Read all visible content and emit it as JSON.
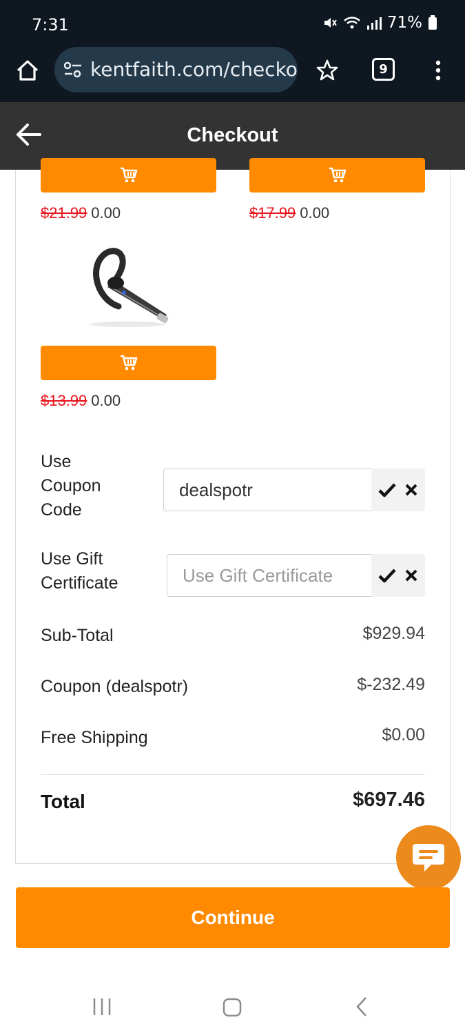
{
  "status_bar": {
    "time": "7:31",
    "battery": "71%",
    "icons": [
      "mute-icon",
      "wifi-icon",
      "signal-icon",
      "battery-icon"
    ]
  },
  "browser": {
    "url": "kentfaith.com/checkout",
    "tab_count": "9",
    "icons": [
      "home-icon",
      "site-settings-icon",
      "bookmark-star-icon",
      "more-vert-icon"
    ]
  },
  "header": {
    "title": "Checkout",
    "back_icon": "arrow-left-icon"
  },
  "products": [
    {
      "old_price": "$21.99",
      "new_price": "0.00"
    },
    {
      "old_price": "$17.99",
      "new_price": "0.00"
    },
    {
      "old_price": "$13.99",
      "new_price": "0.00",
      "image": "bluetooth-headset"
    }
  ],
  "coupon": {
    "label": "Use Coupon Code",
    "value": "dealspotr"
  },
  "gift": {
    "label": "Use Gift Certificate",
    "placeholder": "Use Gift Certificate",
    "value": ""
  },
  "totals": {
    "rows": [
      {
        "label": "Sub-Total",
        "value": "$929.94"
      },
      {
        "label": "Coupon (dealspotr)",
        "value": "$-232.49"
      },
      {
        "label": "Free Shipping",
        "value": "$0.00"
      }
    ],
    "total_label": "Total",
    "total_value": "$697.46"
  },
  "continue_label": "Continue",
  "colors": {
    "accent": "#ff8a00",
    "strike_price": "#e8141b",
    "header_bg": "#333333",
    "browser_bg": "#0f1720",
    "chat_bubble": "#ec8a1c"
  }
}
